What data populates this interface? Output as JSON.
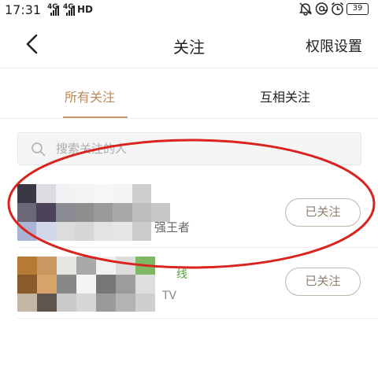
{
  "status_bar": {
    "time": "17:31",
    "network_1": "4G",
    "network_2": "4G",
    "hd_label": "HD",
    "battery": "39",
    "icons": [
      "mute-bell-icon",
      "at-icon",
      "alarm-icon"
    ]
  },
  "header": {
    "title": "关注",
    "right_action": "权限设置",
    "back_icon": "chevron-left-icon"
  },
  "tabs": [
    {
      "label": "所有关注",
      "active": true
    },
    {
      "label": "互相关注",
      "active": false
    }
  ],
  "search": {
    "placeholder": "搜索关注的人",
    "icon": "search-icon"
  },
  "follow_list": [
    {
      "name_visible": "强王者",
      "button_label": "已关注"
    },
    {
      "name_visible": "线",
      "secondary_visible": "TV",
      "button_label": "已关注"
    }
  ],
  "colors": {
    "accent": "#c49a6c",
    "annotation": "#d9231e",
    "button_border": "#bfb5a8"
  }
}
